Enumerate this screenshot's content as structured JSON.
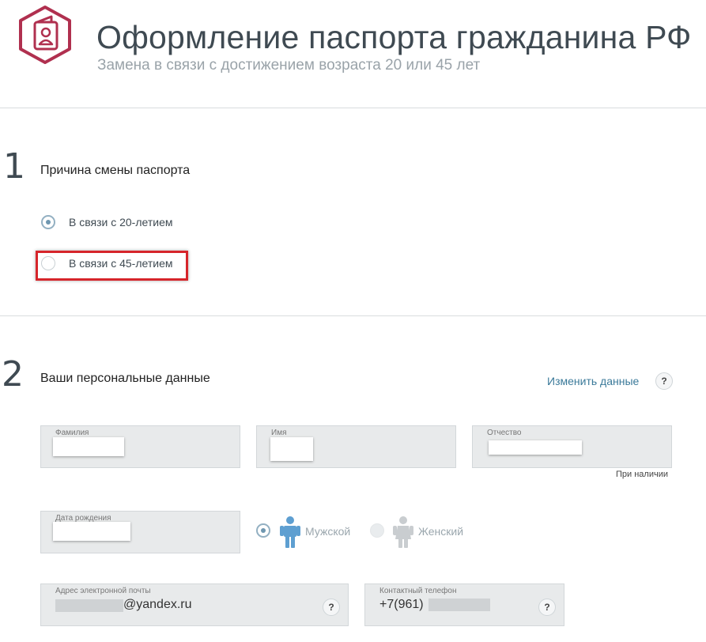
{
  "header": {
    "title": "Оформление паспорта гражданина РФ",
    "subtitle": "Замена в связи с достижением возраста 20 или 45 лет",
    "logo_icon": "passport-icon",
    "brand_color": "#b0304f"
  },
  "step1": {
    "number": "1",
    "title": "Причина смены паспорта",
    "options": [
      {
        "label": "В связи с 20-летием",
        "checked": true
      },
      {
        "label": "В связи с 45-летием",
        "checked": false
      }
    ],
    "highlight_color": "#d6252b"
  },
  "step2": {
    "number": "2",
    "title": "Ваши персональные данные",
    "change_link": "Изменить данные",
    "help_glyph": "?",
    "fields": {
      "last_name": {
        "label": "Фамилия"
      },
      "first_name": {
        "label": "Имя"
      },
      "patronymic": {
        "label": "Отчество",
        "hint": "При наличии"
      },
      "birth_date": {
        "label": "Дата рождения"
      },
      "email": {
        "label": "Адрес электронной почты",
        "value_visible": "@yandex.ru"
      },
      "phone": {
        "label": "Контактный телефон",
        "value_visible": "+7(961)"
      }
    },
    "gender": {
      "male": {
        "label": "Мужской",
        "checked": true,
        "icon": "male-person-icon",
        "color": "#5e9fd1"
      },
      "female": {
        "label": "Женский",
        "checked": false,
        "icon": "female-person-icon",
        "color": "#c9cdd0"
      }
    }
  }
}
